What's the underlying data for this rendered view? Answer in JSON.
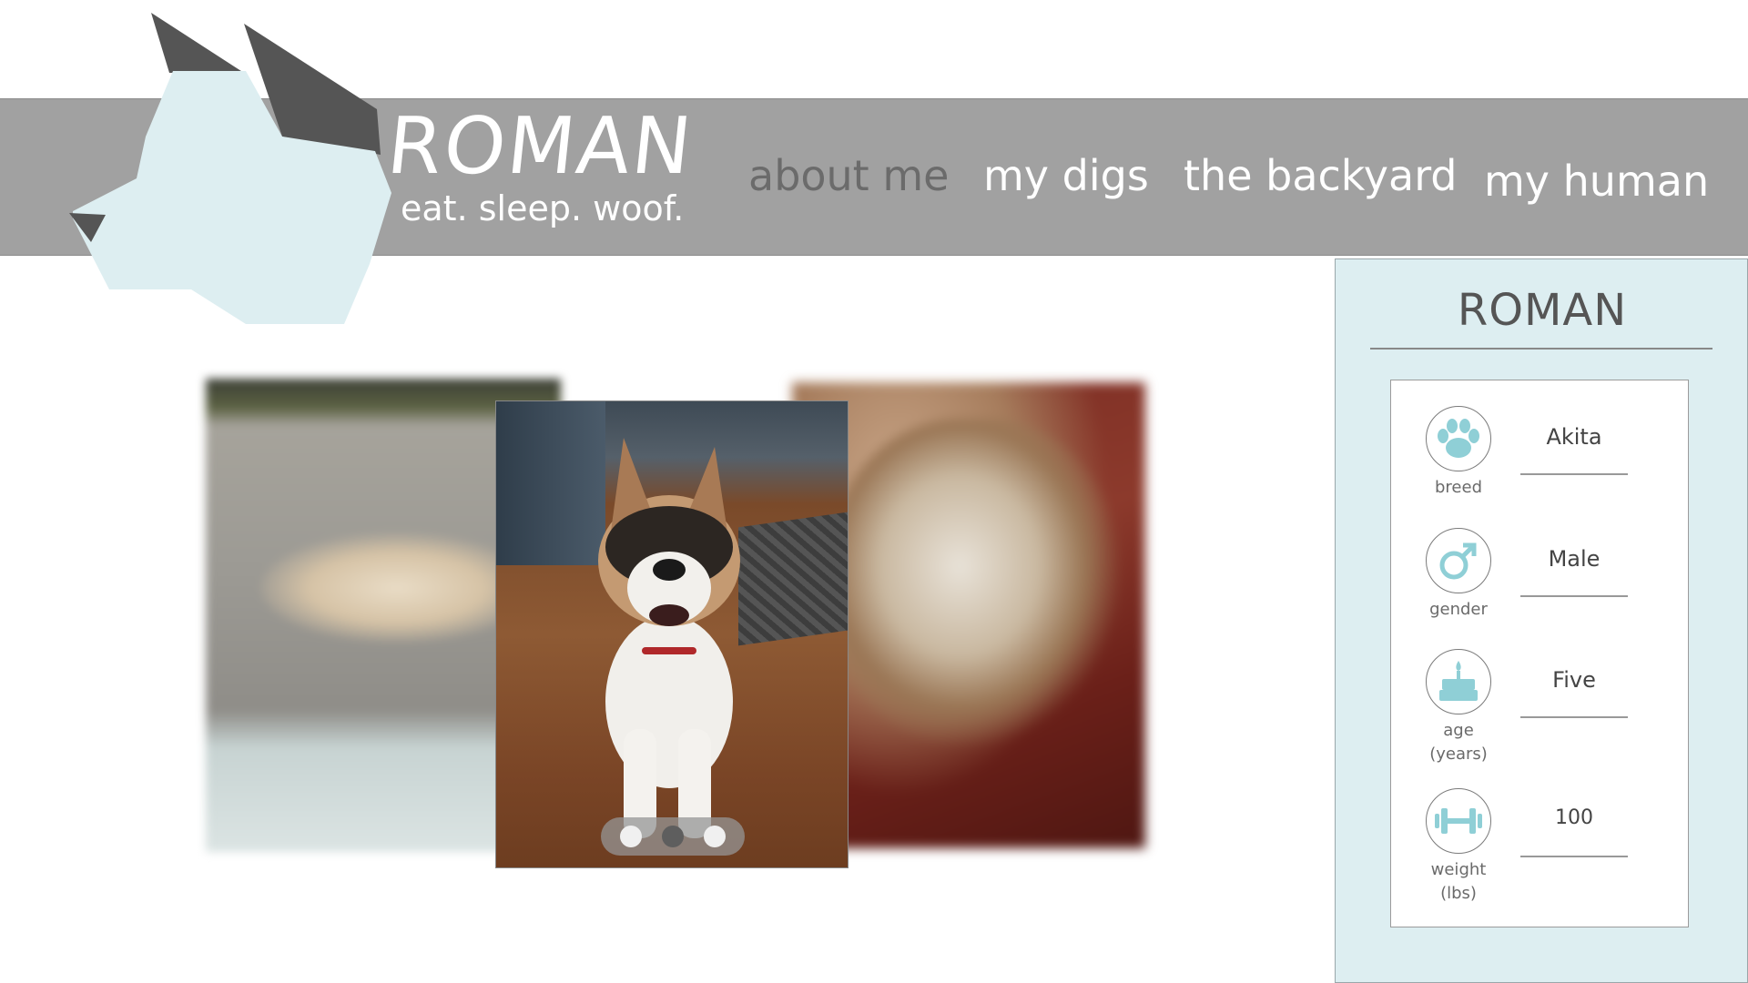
{
  "brand": {
    "title": "ROMAN",
    "tagline": "eat. sleep. woof."
  },
  "nav": {
    "items": [
      {
        "label": "about me",
        "active": true
      },
      {
        "label": "my digs",
        "active": false
      },
      {
        "label": "the backyard",
        "active": false
      },
      {
        "label": "my human",
        "active": false
      }
    ]
  },
  "carousel": {
    "slide_count": 3,
    "active_index": 1
  },
  "profile": {
    "name": "ROMAN",
    "fields": [
      {
        "icon": "paw-icon",
        "label": "breed",
        "label2": "",
        "value": "Akita"
      },
      {
        "icon": "male-symbol-icon",
        "label": "gender",
        "label2": "",
        "value": "Male"
      },
      {
        "icon": "birthday-cake-icon",
        "label": "age",
        "label2": "(years)",
        "value": "Five"
      },
      {
        "icon": "dumbbell-icon",
        "label": "weight",
        "label2": "(lbs)",
        "value": "100"
      }
    ]
  },
  "colors": {
    "header_gray": "#a1a1a1",
    "logo_light_blue": "#ddeef1",
    "logo_dark_gray": "#555555",
    "icon_teal": "#8fcfd6",
    "panel_bg": "#ddeef1"
  }
}
